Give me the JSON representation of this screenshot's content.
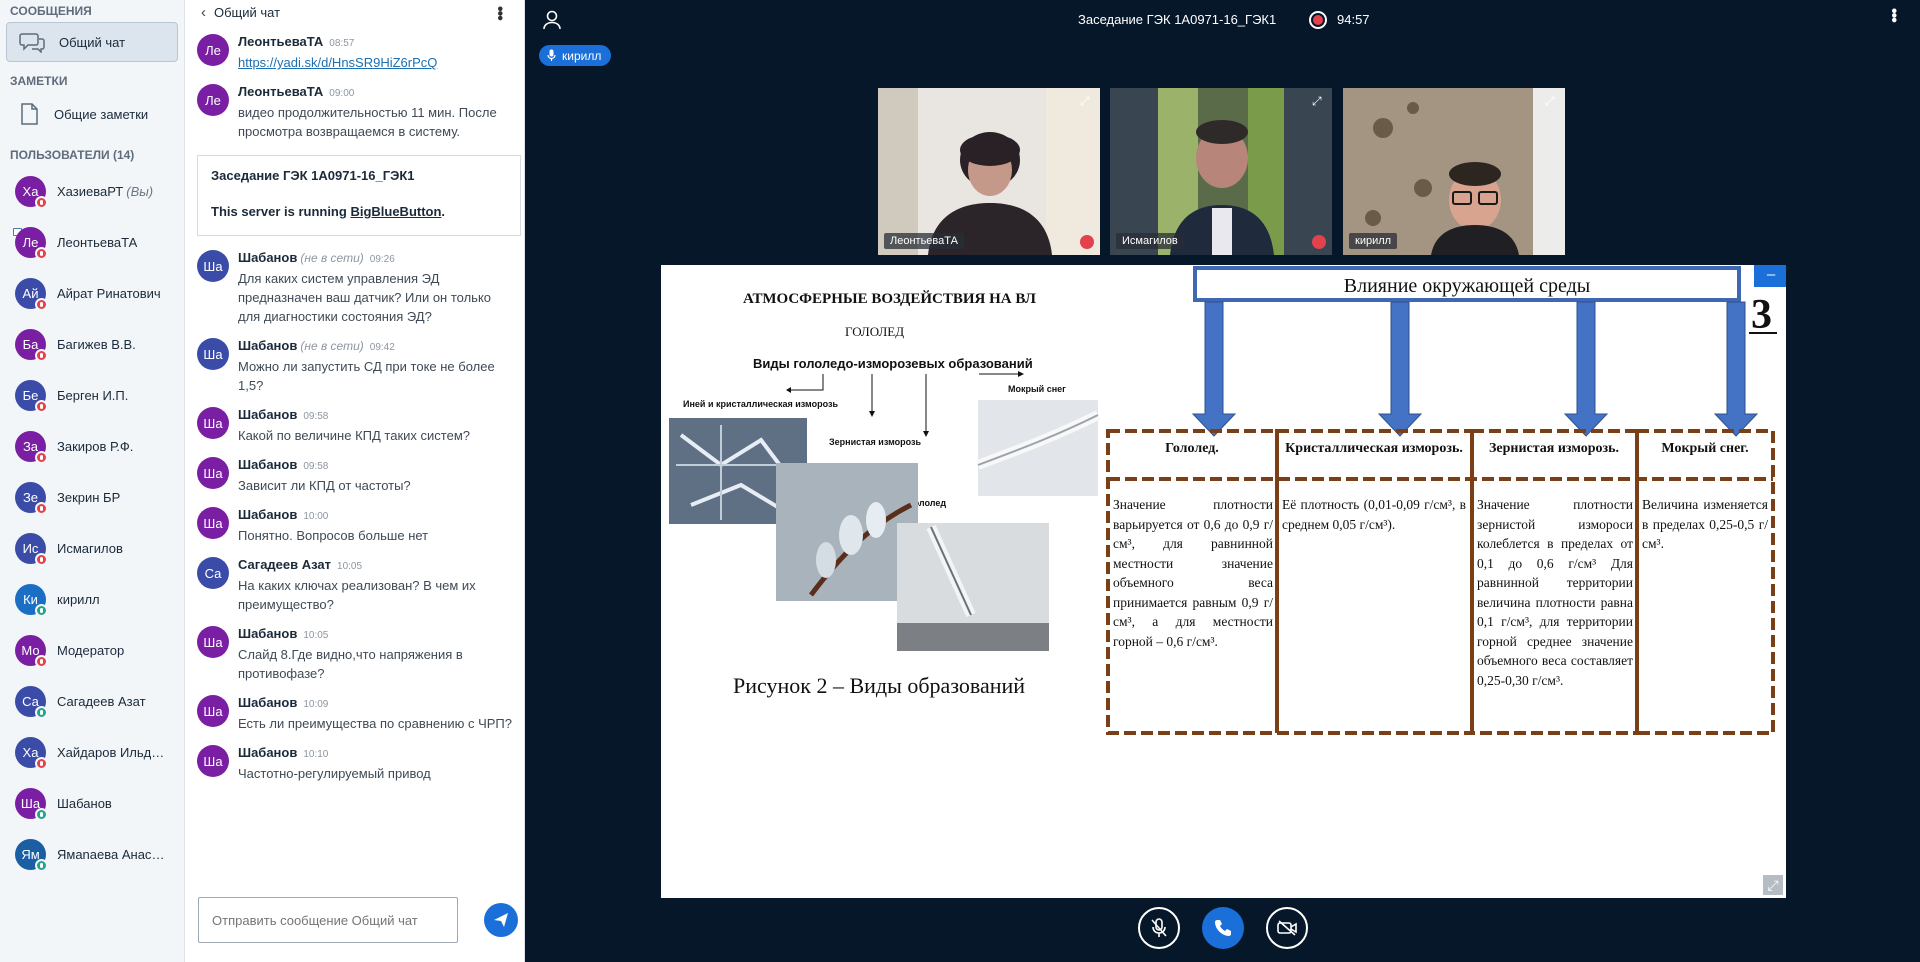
{
  "sidebar": {
    "messages_title": "СООБЩЕНИЯ",
    "public_chat": "Общий чат",
    "notes_title": "ЗАМЕТКИ",
    "shared_notes": "Общие заметки",
    "users_title": "ПОЛЬЗОВАТЕЛИ (14)",
    "users": [
      {
        "initials": "Ха",
        "name": "ХазиеваРТ",
        "you": "(Вы)",
        "color": "#7a1fa3",
        "status": "muted"
      },
      {
        "initials": "Ле",
        "name": "ЛеонтьеваТА",
        "you": "",
        "color": "#7a1fa3",
        "status": "muted",
        "camera": true
      },
      {
        "initials": "Ай",
        "name": "Айрат Ринатович",
        "you": "",
        "color": "#3b4ca8",
        "status": "muted"
      },
      {
        "initials": "Ба",
        "name": "Багижев В.В.",
        "you": "",
        "color": "#7a1fa3",
        "status": "muted"
      },
      {
        "initials": "Бе",
        "name": "Берген И.П.",
        "you": "",
        "color": "#3b4ca8",
        "status": "muted"
      },
      {
        "initials": "За",
        "name": "Закиров Р.Ф.",
        "you": "",
        "color": "#7a1fa3",
        "status": "muted"
      },
      {
        "initials": "Зе",
        "name": "Зекрин БР",
        "you": "",
        "color": "#3b4ca8",
        "status": "muted"
      },
      {
        "initials": "Ис",
        "name": "Исмагилов",
        "you": "",
        "color": "#3b4ca8",
        "status": "muted"
      },
      {
        "initials": "Ки",
        "name": "кирилл",
        "you": "",
        "color": "#1a6fc4",
        "status": "listen"
      },
      {
        "initials": "Мо",
        "name": "Модератор",
        "you": "",
        "color": "#7a1fa3",
        "status": "muted"
      },
      {
        "initials": "Са",
        "name": "Сагадеев Азат",
        "you": "",
        "color": "#3b4ca8",
        "status": "listen"
      },
      {
        "initials": "Ха",
        "name": "Хайдаров Ильдар ...",
        "you": "",
        "color": "#3b4ca8",
        "status": "muted"
      },
      {
        "initials": "Ша",
        "name": "Шабанов",
        "you": "",
        "color": "#7a1fa3",
        "status": "listen"
      },
      {
        "initials": "Ям",
        "name": "Ямanaева Анаcат...",
        "you": "",
        "color": "#1a5fa3",
        "status": "listen"
      }
    ]
  },
  "chat": {
    "header": "Общий чат",
    "messages": [
      {
        "initials": "Ле",
        "color": "#7a1fa3",
        "author": "ЛеонтьеваТА",
        "offline": "",
        "time": "08:57",
        "text": "",
        "link": "https://yadi.sk/d/HnsSR9HiZ6rPcQ"
      },
      {
        "initials": "Ле",
        "color": "#7a1fa3",
        "author": "ЛеонтьеваТА",
        "offline": "",
        "time": "09:00",
        "text": "видео продолжительностью 11 мин. После просмотра возвращаемся в систему.",
        "link": ""
      }
    ],
    "welcome_title": "Заседание ГЭК 1А0971-16_ГЭК1",
    "welcome_text": "This server is running ",
    "welcome_link": "BigBlueButton",
    "welcome_end": ".",
    "messages2": [
      {
        "initials": "Ша",
        "color": "#3b4ca8",
        "author": "Шабанов",
        "offline": "(не в сети)",
        "time": "09:26",
        "text": "Для каких систем управления ЭД предназначен ваш датчик? Или он только для диагностики состояния ЭД?"
      },
      {
        "initials": "Ша",
        "color": "#3b4ca8",
        "author": "Шабанов",
        "offline": "(не в сети)",
        "time": "09:42",
        "text": "Можно ли запустить СД при токе не более 1,5?"
      },
      {
        "initials": "Ша",
        "color": "#7a1fa3",
        "author": "Шабанов",
        "offline": "",
        "time": "09:58",
        "text": "Какой по величине КПД таких систем?"
      },
      {
        "initials": "Ша",
        "color": "#7a1fa3",
        "author": "Шабанов",
        "offline": "",
        "time": "09:58",
        "text": "Зависит ли КПД от частоты?"
      },
      {
        "initials": "Ша",
        "color": "#7a1fa3",
        "author": "Шабанов",
        "offline": "",
        "time": "10:00",
        "text": "Понятно. Вопросов больше нет"
      },
      {
        "initials": "Са",
        "color": "#3b4ca8",
        "author": "Сагадеев Азат",
        "offline": "",
        "time": "10:05",
        "text": "На каких ключах реализован? В чем их преимущество?"
      },
      {
        "initials": "Ша",
        "color": "#7a1fa3",
        "author": "Шабанов",
        "offline": "",
        "time": "10:05",
        "text": "Слайд 8.Где видно,что напряжения в противофазе?"
      },
      {
        "initials": "Ша",
        "color": "#7a1fa3",
        "author": "Шабанов",
        "offline": "",
        "time": "10:09",
        "text": "Есть ли преимущества по сравнению с ЧРП?"
      },
      {
        "initials": "Ша",
        "color": "#7a1fa3",
        "author": "Шабанов",
        "offline": "",
        "time": "10:10",
        "text": "Частотно-регулируемый привод"
      }
    ],
    "input_placeholder": "Отправить сообщение Общий чат"
  },
  "meeting": {
    "title": "Заседание ГЭК 1А0971-16_ГЭК1",
    "rec_time": "94:57",
    "talker": "кирилл"
  },
  "videos": [
    {
      "name": "ЛеонтьеваТА",
      "muted": true
    },
    {
      "name": "Исмагилов",
      "muted": true
    },
    {
      "name": "кирилл",
      "muted": false
    }
  ],
  "slide": {
    "heading": "АТМОСФЕРНЫЕ ВОЗДЕЙСТВИЯ НА ВЛ",
    "subheading": "ГОЛОЛЕД",
    "types_title": "Виды гололедо-изморозевых образований",
    "label_ineiy": "Иней и кристаллическая изморозь",
    "label_zern": "Зернистая изморозь",
    "label_gololed": "Гололед",
    "label_sneg": "Мокрый снег",
    "caption": "Рисунок 2 – Виды образований",
    "influence_title": "Влияние окружающей среды",
    "slide_number": "3",
    "columns": [
      {
        "title": "Гололед.",
        "text": "Значение плотности варьируется от 0,6 до 0,9 г/см³, для равнинной местности значение объемного веса принимается равным 0,9 г/см³, а для местности горной – 0,6 г/см³."
      },
      {
        "title": "Кристаллическая изморозь.",
        "text": "Её плотность (0,01-0,09 г/см³, в среднем 0,05 г/см³)."
      },
      {
        "title": "Зернистая изморозь.",
        "text": "Значение плотности зернистой измороси колеблется в пределах от 0,1 до 0,6 г/см³ Для равнинной территории величина плотности равна 0,1 г/см³, для территории горной среднее значение объемного веса составляет 0,25-0,30 г/см³."
      },
      {
        "title": "Мокрый снег.",
        "text": "Величина изменяется в пределах 0,25-0,5 г/см³."
      }
    ]
  }
}
